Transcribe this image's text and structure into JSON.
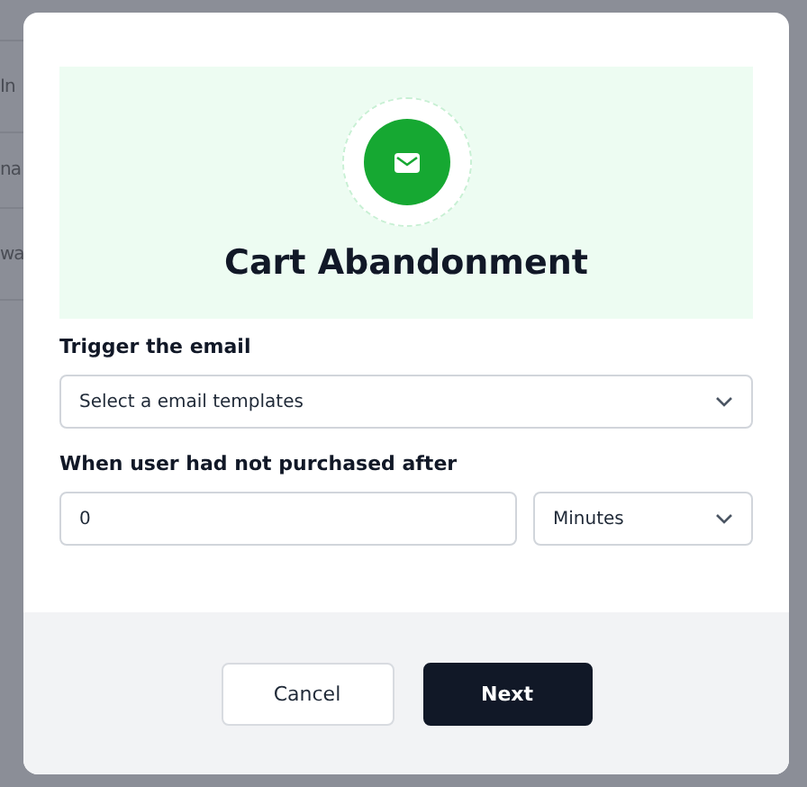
{
  "background_fragments": [
    "In",
    "na",
    "wa"
  ],
  "dialog": {
    "title": "Cart Abandonment",
    "fields": [
      {
        "kind": "select",
        "label": "Trigger the email",
        "placeholder": "Select a email templates"
      },
      {
        "kind": "number-with-unit",
        "label": "When user had not purchased after",
        "value": "0",
        "unit": "Minutes"
      }
    ],
    "buttons": [
      {
        "label": "Cancel",
        "kind": "secondary"
      },
      {
        "label": "Next",
        "kind": "primary"
      }
    ]
  }
}
